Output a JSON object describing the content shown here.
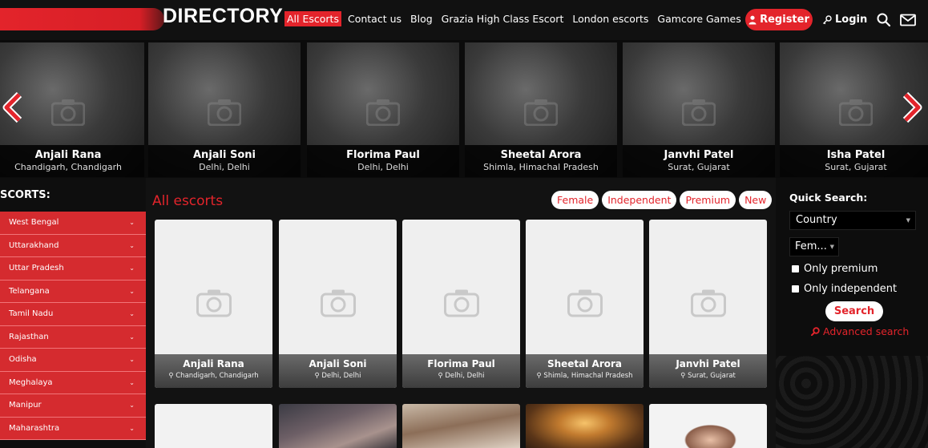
{
  "header": {
    "logo_text": "DIRECTORY",
    "nav": [
      "All Escorts",
      "Contact us",
      "Blog",
      "Grazia High Class Escort",
      "London escorts",
      "Gamcore Games"
    ],
    "register_label": "Register",
    "login_label": "Login",
    "accent": "#e3242b"
  },
  "carousel": [
    {
      "name": "Anjali Rana",
      "location": "Chandigarh, Chandigarh"
    },
    {
      "name": "Anjali Soni",
      "location": "Delhi, Delhi"
    },
    {
      "name": "Florima Paul",
      "location": "Delhi, Delhi"
    },
    {
      "name": "Sheetal Arora",
      "location": "Shimla, Himachal Pradesh"
    },
    {
      "name": "Janvhi Patel",
      "location": "Surat, Gujarat"
    },
    {
      "name": "Isha Patel",
      "location": "Surat, Gujarat"
    }
  ],
  "sidebar": {
    "title": "SCORTS:",
    "items": [
      "West Bengal",
      "Uttarakhand",
      "Uttar Pradesh",
      "Telangana",
      "Tamil Nadu",
      "Rajasthan",
      "Odisha",
      "Meghalaya",
      "Manipur",
      "Maharashtra"
    ]
  },
  "main": {
    "heading": "All escorts",
    "filters": [
      "Female",
      "Independent",
      "Premium",
      "New"
    ],
    "cards": [
      {
        "name": "Anjali Rana",
        "location": "Chandigarh, Chandigarh"
      },
      {
        "name": "Anjali Soni",
        "location": "Delhi, Delhi"
      },
      {
        "name": "Florima Paul",
        "location": "Delhi, Delhi"
      },
      {
        "name": "Sheetal Arora",
        "location": "Shimla, Himachal Pradesh"
      },
      {
        "name": "Janvhi Patel",
        "location": "Surat, Gujarat"
      }
    ]
  },
  "quick_search": {
    "title": "Quick Search:",
    "country_value": "Country",
    "gender_value": "Fem...",
    "only_premium": "Only premium",
    "only_independent": "Only independent",
    "search_label": "Search",
    "advanced_label": "Advanced search"
  }
}
